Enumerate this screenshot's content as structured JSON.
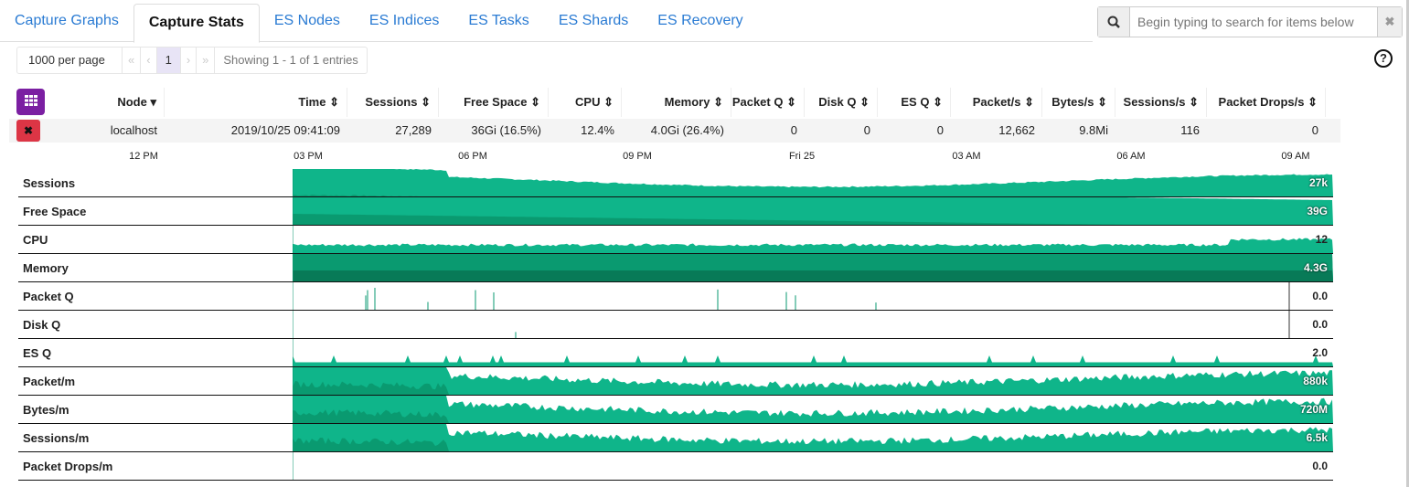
{
  "tabs": [
    {
      "label": "Capture Graphs"
    },
    {
      "label": "Capture Stats",
      "active": true
    },
    {
      "label": "ES Nodes"
    },
    {
      "label": "ES Indices"
    },
    {
      "label": "ES Tasks"
    },
    {
      "label": "ES Shards"
    },
    {
      "label": "ES Recovery"
    }
  ],
  "search": {
    "placeholder": "Begin typing to search for items below",
    "icon": "search-icon",
    "clear": "✖"
  },
  "help": "?",
  "pager": {
    "per_page": "1000 per page",
    "first": "«",
    "prev": "‹",
    "current": "1",
    "next": "›",
    "last": "»",
    "info": "Showing 1 - 1 of 1 entries"
  },
  "table": {
    "columns": [
      {
        "label": "Node",
        "sort": "▾"
      },
      {
        "label": "Time",
        "sort": "⇕"
      },
      {
        "label": "Sessions",
        "sort": "⇕"
      },
      {
        "label": "Free Space",
        "sort": "⇕"
      },
      {
        "label": "CPU",
        "sort": "⇕"
      },
      {
        "label": "Memory",
        "sort": "⇕"
      },
      {
        "label": "Packet Q",
        "sort": "⇕"
      },
      {
        "label": "Disk Q",
        "sort": "⇕"
      },
      {
        "label": "ES Q",
        "sort": "⇕"
      },
      {
        "label": "Packet/s",
        "sort": "⇕"
      },
      {
        "label": "Bytes/s",
        "sort": "⇕"
      },
      {
        "label": "Sessions/s",
        "sort": "⇕"
      },
      {
        "label": "Packet Drops/s",
        "sort": "⇕"
      }
    ],
    "rows": [
      [
        "localhost",
        "2019/10/25 09:41:09",
        "27,289",
        "36Gi (16.5%)",
        "12.4%",
        "4.0Gi (26.4%)",
        "0",
        "0",
        "0",
        "12,662",
        "9.8Mi",
        "116",
        "0"
      ]
    ]
  },
  "axis": [
    "12 PM",
    "03 PM",
    "06 PM",
    "09 PM",
    "Fri 25",
    "03 AM",
    "06 AM",
    "09 AM"
  ],
  "colors": {
    "horizon1": "#0fb58a",
    "horizon2": "#0a9a70",
    "horizon3": "#087a57",
    "purple": "#7b1fa2",
    "red": "#dc3545"
  },
  "graphs": [
    {
      "label": "Sessions",
      "value": "27k"
    },
    {
      "label": "Free Space",
      "value": "39G"
    },
    {
      "label": "CPU",
      "value": "12"
    },
    {
      "label": "Memory",
      "value": "4.3G"
    },
    {
      "label": "Packet Q",
      "value": "0.0"
    },
    {
      "label": "Disk Q",
      "value": "0.0"
    },
    {
      "label": "ES Q",
      "value": "2.0"
    },
    {
      "label": "Packet/m",
      "value": "880k"
    },
    {
      "label": "Bytes/m",
      "value": "720M"
    },
    {
      "label": "Sessions/m",
      "value": "6.5k"
    },
    {
      "label": "Packet Drops/m",
      "value": "0.0"
    }
  ]
}
